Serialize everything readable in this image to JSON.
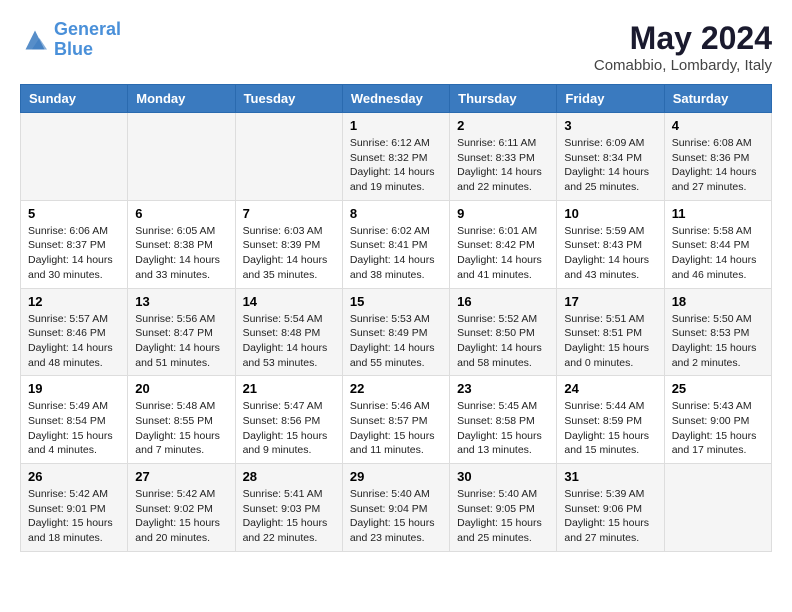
{
  "logo": {
    "line1": "General",
    "line2": "Blue"
  },
  "title": "May 2024",
  "location": "Comabbio, Lombardy, Italy",
  "days_header": [
    "Sunday",
    "Monday",
    "Tuesday",
    "Wednesday",
    "Thursday",
    "Friday",
    "Saturday"
  ],
  "weeks": [
    [
      {
        "day": "",
        "text": ""
      },
      {
        "day": "",
        "text": ""
      },
      {
        "day": "",
        "text": ""
      },
      {
        "day": "1",
        "text": "Sunrise: 6:12 AM\nSunset: 8:32 PM\nDaylight: 14 hours\nand 19 minutes."
      },
      {
        "day": "2",
        "text": "Sunrise: 6:11 AM\nSunset: 8:33 PM\nDaylight: 14 hours\nand 22 minutes."
      },
      {
        "day": "3",
        "text": "Sunrise: 6:09 AM\nSunset: 8:34 PM\nDaylight: 14 hours\nand 25 minutes."
      },
      {
        "day": "4",
        "text": "Sunrise: 6:08 AM\nSunset: 8:36 PM\nDaylight: 14 hours\nand 27 minutes."
      }
    ],
    [
      {
        "day": "5",
        "text": "Sunrise: 6:06 AM\nSunset: 8:37 PM\nDaylight: 14 hours\nand 30 minutes."
      },
      {
        "day": "6",
        "text": "Sunrise: 6:05 AM\nSunset: 8:38 PM\nDaylight: 14 hours\nand 33 minutes."
      },
      {
        "day": "7",
        "text": "Sunrise: 6:03 AM\nSunset: 8:39 PM\nDaylight: 14 hours\nand 35 minutes."
      },
      {
        "day": "8",
        "text": "Sunrise: 6:02 AM\nSunset: 8:41 PM\nDaylight: 14 hours\nand 38 minutes."
      },
      {
        "day": "9",
        "text": "Sunrise: 6:01 AM\nSunset: 8:42 PM\nDaylight: 14 hours\nand 41 minutes."
      },
      {
        "day": "10",
        "text": "Sunrise: 5:59 AM\nSunset: 8:43 PM\nDaylight: 14 hours\nand 43 minutes."
      },
      {
        "day": "11",
        "text": "Sunrise: 5:58 AM\nSunset: 8:44 PM\nDaylight: 14 hours\nand 46 minutes."
      }
    ],
    [
      {
        "day": "12",
        "text": "Sunrise: 5:57 AM\nSunset: 8:46 PM\nDaylight: 14 hours\nand 48 minutes."
      },
      {
        "day": "13",
        "text": "Sunrise: 5:56 AM\nSunset: 8:47 PM\nDaylight: 14 hours\nand 51 minutes."
      },
      {
        "day": "14",
        "text": "Sunrise: 5:54 AM\nSunset: 8:48 PM\nDaylight: 14 hours\nand 53 minutes."
      },
      {
        "day": "15",
        "text": "Sunrise: 5:53 AM\nSunset: 8:49 PM\nDaylight: 14 hours\nand 55 minutes."
      },
      {
        "day": "16",
        "text": "Sunrise: 5:52 AM\nSunset: 8:50 PM\nDaylight: 14 hours\nand 58 minutes."
      },
      {
        "day": "17",
        "text": "Sunrise: 5:51 AM\nSunset: 8:51 PM\nDaylight: 15 hours\nand 0 minutes."
      },
      {
        "day": "18",
        "text": "Sunrise: 5:50 AM\nSunset: 8:53 PM\nDaylight: 15 hours\nand 2 minutes."
      }
    ],
    [
      {
        "day": "19",
        "text": "Sunrise: 5:49 AM\nSunset: 8:54 PM\nDaylight: 15 hours\nand 4 minutes."
      },
      {
        "day": "20",
        "text": "Sunrise: 5:48 AM\nSunset: 8:55 PM\nDaylight: 15 hours\nand 7 minutes."
      },
      {
        "day": "21",
        "text": "Sunrise: 5:47 AM\nSunset: 8:56 PM\nDaylight: 15 hours\nand 9 minutes."
      },
      {
        "day": "22",
        "text": "Sunrise: 5:46 AM\nSunset: 8:57 PM\nDaylight: 15 hours\nand 11 minutes."
      },
      {
        "day": "23",
        "text": "Sunrise: 5:45 AM\nSunset: 8:58 PM\nDaylight: 15 hours\nand 13 minutes."
      },
      {
        "day": "24",
        "text": "Sunrise: 5:44 AM\nSunset: 8:59 PM\nDaylight: 15 hours\nand 15 minutes."
      },
      {
        "day": "25",
        "text": "Sunrise: 5:43 AM\nSunset: 9:00 PM\nDaylight: 15 hours\nand 17 minutes."
      }
    ],
    [
      {
        "day": "26",
        "text": "Sunrise: 5:42 AM\nSunset: 9:01 PM\nDaylight: 15 hours\nand 18 minutes."
      },
      {
        "day": "27",
        "text": "Sunrise: 5:42 AM\nSunset: 9:02 PM\nDaylight: 15 hours\nand 20 minutes."
      },
      {
        "day": "28",
        "text": "Sunrise: 5:41 AM\nSunset: 9:03 PM\nDaylight: 15 hours\nand 22 minutes."
      },
      {
        "day": "29",
        "text": "Sunrise: 5:40 AM\nSunset: 9:04 PM\nDaylight: 15 hours\nand 23 minutes."
      },
      {
        "day": "30",
        "text": "Sunrise: 5:40 AM\nSunset: 9:05 PM\nDaylight: 15 hours\nand 25 minutes."
      },
      {
        "day": "31",
        "text": "Sunrise: 5:39 AM\nSunset: 9:06 PM\nDaylight: 15 hours\nand 27 minutes."
      },
      {
        "day": "",
        "text": ""
      }
    ]
  ]
}
